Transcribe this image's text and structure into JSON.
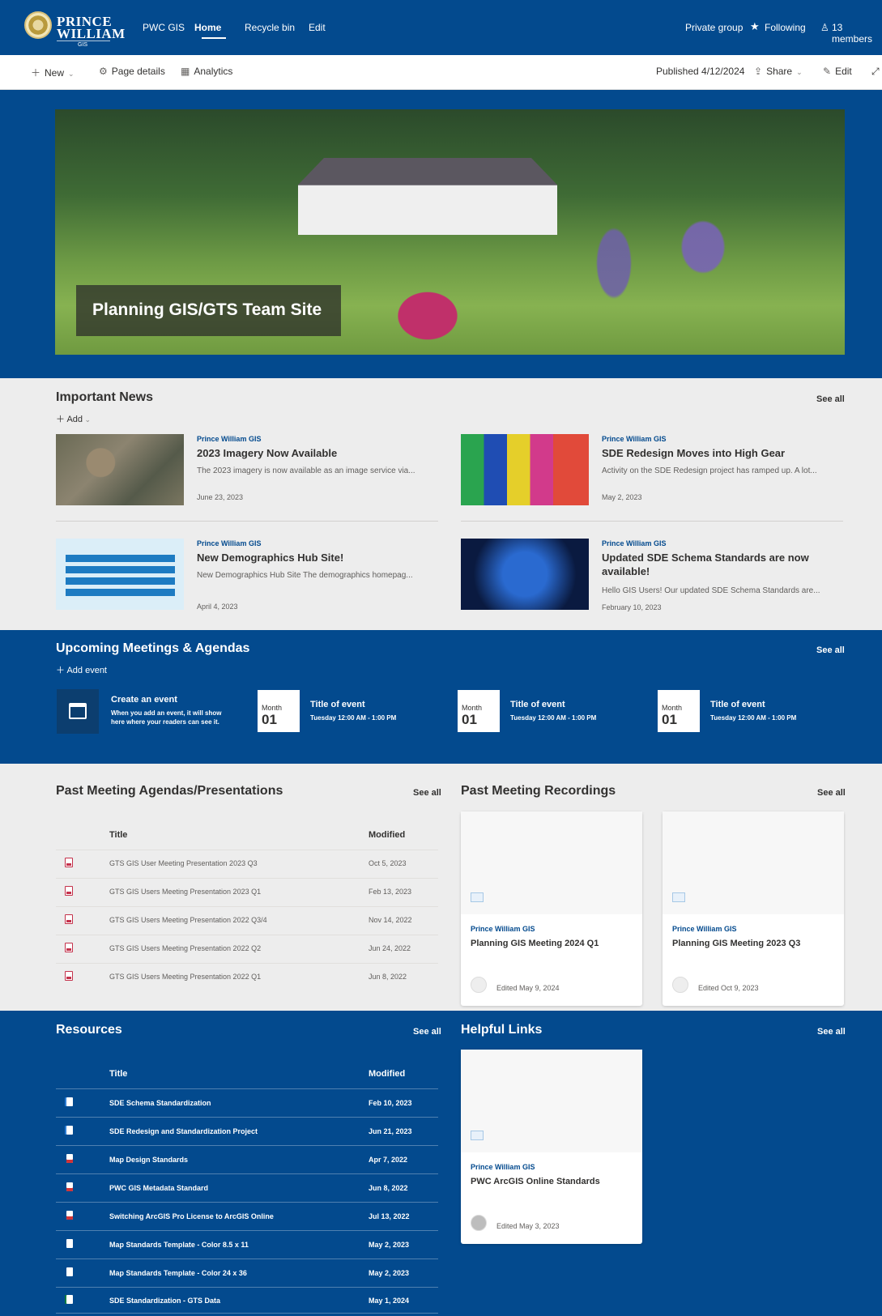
{
  "suite_nav": {
    "logo_line1": "PRINCE",
    "logo_line2": "WILLIAM",
    "logo_sub": "GIS",
    "links": [
      "PWC GIS",
      "Home",
      "Recycle bin",
      "Edit"
    ],
    "private_group": "Private group",
    "following": "Following",
    "members": "13 members"
  },
  "command_bar": {
    "new": "New",
    "page_details": "Page details",
    "analytics": "Analytics",
    "published": "Published 4/12/2024",
    "share": "Share",
    "edit": "Edit"
  },
  "hero": {
    "title": "Planning GIS/GTS Team Site"
  },
  "news": {
    "title": "Important News",
    "see_all": "See all",
    "add": "Add",
    "items": [
      {
        "source": "Prince William GIS",
        "title": "2023 Imagery Now Available",
        "desc": "The 2023 imagery is now available as an image service via...",
        "date": "June 23, 2023"
      },
      {
        "source": "Prince William GIS",
        "title": "SDE Redesign Moves into High Gear",
        "desc": "Activity on the SDE Redesign project has ramped up. A lot...",
        "date": "May 2, 2023"
      },
      {
        "source": "Prince William GIS",
        "title": "New Demographics Hub Site!",
        "desc": "New Demographics Hub Site The demographics homepag...",
        "date": "April 4, 2023"
      },
      {
        "source": "Prince William GIS",
        "title": "Updated SDE Schema Standards are now",
        "title2": "available!",
        "desc": "Hello GIS Users! Our updated SDE Schema Standards are...",
        "date": "February 10, 2023"
      }
    ]
  },
  "meetings": {
    "title": "Upcoming Meetings & Agendas",
    "see_all": "See all",
    "add_event": "Add event",
    "create_title": "Create an event",
    "create_desc1": "When you add an event, it will show",
    "create_desc2": "here where your readers can see it.",
    "events": [
      {
        "month": "Month",
        "day": "01",
        "title": "Title of event",
        "time": "Tuesday 12:00 AM - 1:00 PM"
      },
      {
        "month": "Month",
        "day": "01",
        "title": "Title of event",
        "time": "Tuesday 12:00 AM - 1:00 PM"
      },
      {
        "month": "Month",
        "day": "01",
        "title": "Title of event",
        "time": "Tuesday 12:00 AM - 1:00 PM"
      }
    ]
  },
  "past_agendas": {
    "title": "Past Meeting Agendas/Presentations",
    "see_all": "See all",
    "col_title": "Title",
    "col_modified": "Modified",
    "rows": [
      {
        "title": "GTS GIS User Meeting Presentation 2023 Q3",
        "modified": "Oct 5, 2023"
      },
      {
        "title": "GTS GIS Users Meeting Presentation 2023 Q1",
        "modified": "Feb 13, 2023"
      },
      {
        "title": "GTS GIS Users Meeting Presentation 2022 Q3/4",
        "modified": "Nov 14, 2022"
      },
      {
        "title": "GTS GIS Users Meeting Presentation 2022 Q2",
        "modified": "Jun 24, 2022"
      },
      {
        "title": "GTS GIS Users Meeting Presentation 2022 Q1",
        "modified": "Jun 8, 2022"
      }
    ]
  },
  "recordings": {
    "title": "Past Meeting Recordings",
    "see_all": "See all",
    "cards": [
      {
        "source": "Prince William GIS",
        "title": "Planning GIS Meeting 2024 Q1",
        "edited": "Edited May 9, 2024"
      },
      {
        "source": "Prince William GIS",
        "title": "Planning GIS Meeting 2023 Q3",
        "edited": "Edited Oct 9, 2023"
      }
    ]
  },
  "resources": {
    "title": "Resources",
    "see_all": "See all",
    "col_title": "Title",
    "col_modified": "Modified",
    "rows": [
      {
        "title": "SDE Schema Standardization",
        "modified": "Feb 10, 2023",
        "icon": "word-doc-icon"
      },
      {
        "title": "SDE Redesign and Standardization Project",
        "modified": "Jun 21, 2023",
        "icon": "word-doc-icon"
      },
      {
        "title": "Map Design Standards",
        "modified": "Apr 7, 2022",
        "icon": "pdf-icon"
      },
      {
        "title": "PWC GIS Metadata Standard",
        "modified": "Jun 8, 2022",
        "icon": "pdf-icon"
      },
      {
        "title": "Switching ArcGIS Pro License to ArcGIS Online",
        "modified": "Jul 13, 2022",
        "icon": "pdf-icon"
      },
      {
        "title": "Map Standards Template - Color 8.5 x 11",
        "modified": "May 2, 2023",
        "icon": "file-icon"
      },
      {
        "title": "Map Standards Template - Color 24 x 36",
        "modified": "May 2, 2023",
        "icon": "file-icon"
      },
      {
        "title": "SDE Standardization - GTS Data",
        "modified": "May 1, 2024",
        "icon": "excel-icon"
      }
    ]
  },
  "helpful_links": {
    "title": "Helpful Links",
    "see_all": "See all",
    "card": {
      "source": "Prince William GIS",
      "title": "PWC ArcGIS Online Standards",
      "edited": "Edited May 3, 2023"
    }
  },
  "colors": {
    "brand": "#034a8e",
    "page_bg": "#ededed"
  }
}
